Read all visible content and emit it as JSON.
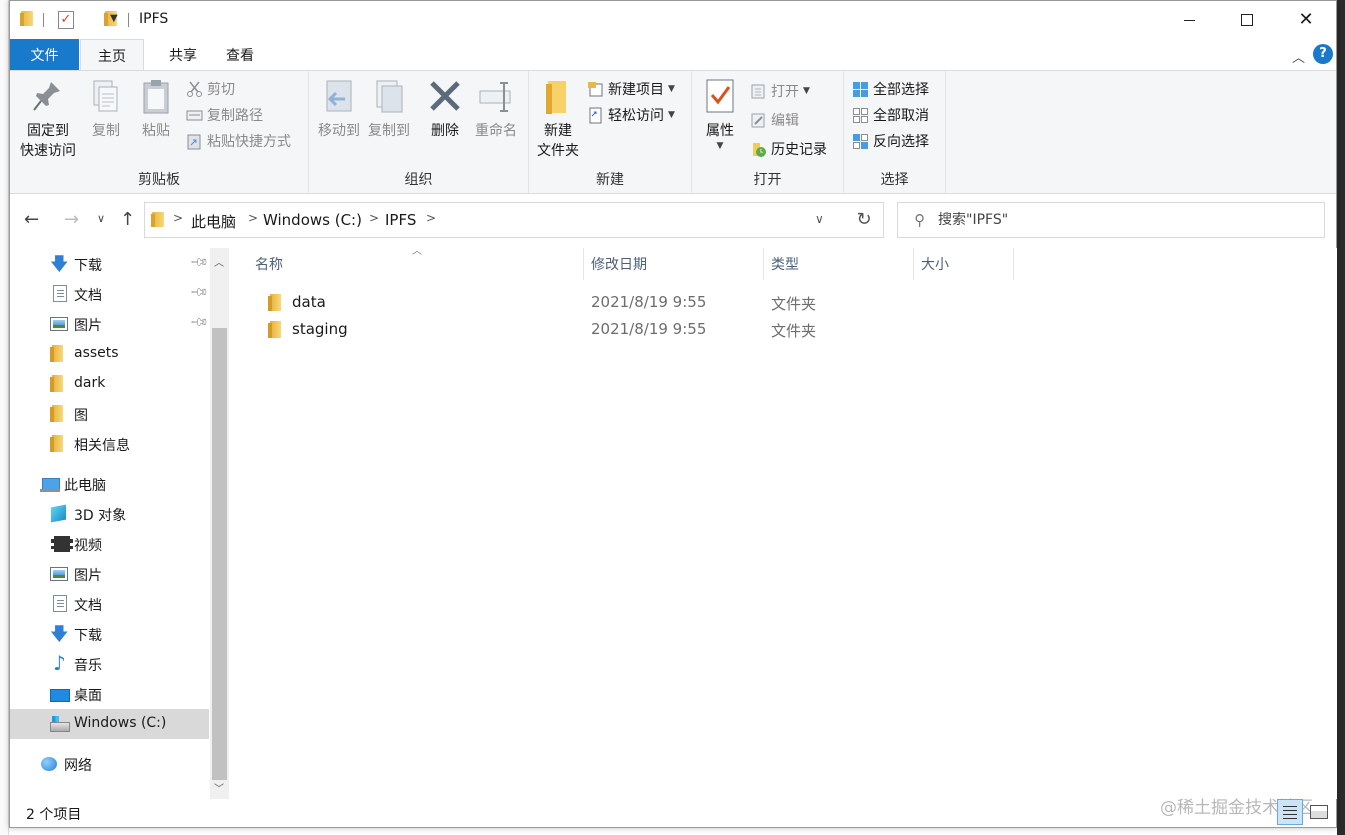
{
  "window": {
    "title": "IPFS"
  },
  "ribbon": {
    "tabs": {
      "file": "文件",
      "home": "主页",
      "share": "共享",
      "view": "查看"
    },
    "help": "?",
    "clipboard": {
      "pin_quick_access": "固定到\n快速访问",
      "pin_line1": "固定到",
      "pin_line2": "快速访问",
      "copy": "复制",
      "paste": "粘贴",
      "cut": "剪切",
      "copy_path": "复制路径",
      "paste_shortcut": "粘贴快捷方式",
      "label": "剪贴板"
    },
    "organize": {
      "move_to": "移动到",
      "copy_to": "复制到",
      "delete": "删除",
      "rename": "重命名",
      "label": "组织"
    },
    "new": {
      "new_folder_line1": "新建",
      "new_folder_line2": "文件夹",
      "new_item": "新建项目",
      "easy_access": "轻松访问",
      "label": "新建"
    },
    "open": {
      "properties": "属性",
      "open": "打开",
      "edit": "编辑",
      "history": "历史记录",
      "label": "打开"
    },
    "select": {
      "select_all": "全部选择",
      "select_none": "全部取消",
      "invert": "反向选择",
      "label": "选择"
    }
  },
  "address": {
    "crumbs": [
      "此电脑",
      "Windows (C:)",
      "IPFS"
    ],
    "search_placeholder": "搜索\"IPFS\""
  },
  "nav_pane": {
    "quick_access": [
      {
        "label": "下载",
        "icon": "download-icon",
        "pinned": true
      },
      {
        "label": "文档",
        "icon": "document-icon",
        "pinned": true
      },
      {
        "label": "图片",
        "icon": "picture-icon",
        "pinned": true
      },
      {
        "label": "assets",
        "icon": "folder-icon",
        "pinned": false
      },
      {
        "label": "dark",
        "icon": "folder-icon",
        "pinned": false
      },
      {
        "label": "图",
        "icon": "folder-icon",
        "pinned": false
      },
      {
        "label": "相关信息",
        "icon": "folder-icon",
        "pinned": false
      }
    ],
    "this_pc": {
      "label": "此电脑",
      "items": [
        {
          "label": "3D 对象",
          "icon": "3d-objects-icon"
        },
        {
          "label": "视频",
          "icon": "video-icon"
        },
        {
          "label": "图片",
          "icon": "picture-icon"
        },
        {
          "label": "文档",
          "icon": "document-icon"
        },
        {
          "label": "下载",
          "icon": "download-icon"
        },
        {
          "label": "音乐",
          "icon": "music-icon"
        },
        {
          "label": "桌面",
          "icon": "desktop-icon"
        },
        {
          "label": "Windows (C:)",
          "icon": "drive-icon",
          "selected": true
        }
      ]
    },
    "network": "网络"
  },
  "file_list": {
    "columns": {
      "name": "名称",
      "date": "修改日期",
      "type": "类型",
      "size": "大小"
    },
    "rows": [
      {
        "name": "data",
        "date": "2021/8/19 9:55",
        "type": "文件夹",
        "size": ""
      },
      {
        "name": "staging",
        "date": "2021/8/19 9:55",
        "type": "文件夹",
        "size": ""
      }
    ]
  },
  "status": {
    "count": "2 个项目",
    "watermark": "@稀土掘金技术社区"
  },
  "colors": {
    "accent": "#1979ca",
    "ribbon_bg": "#f5f6f7",
    "selected_nav": "#d9d9d9",
    "column_header_text": "#4c607a"
  }
}
